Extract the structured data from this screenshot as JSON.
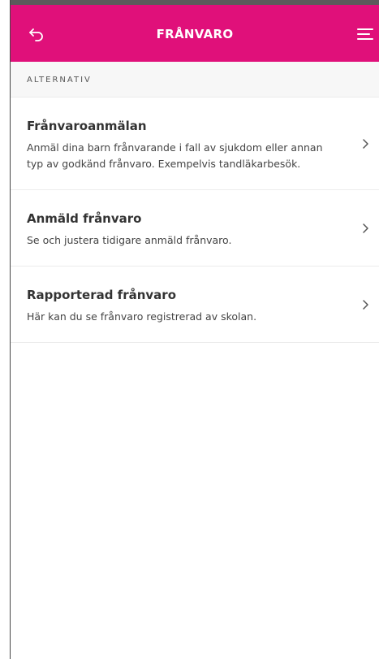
{
  "header": {
    "title": "FRÅNVARO",
    "back_icon": "back-arrow-icon",
    "menu_icon": "hamburger-menu-icon",
    "background_color": "#e0107a"
  },
  "section": {
    "label": "ALTERNATIV"
  },
  "items": [
    {
      "title": "Frånvaroanmälan",
      "description": "Anmäl dina barn frånvarande i fall av sjukdom eller annan typ av godkänd frånvaro. Exempelvis tandläkarbesök."
    },
    {
      "title": "Anmäld frånvaro",
      "description": "Se och justera tidigare anmäld frånvaro."
    },
    {
      "title": "Rapporterad frånvaro",
      "description": "Här kan du se frånvaro registrerad av skolan."
    }
  ]
}
